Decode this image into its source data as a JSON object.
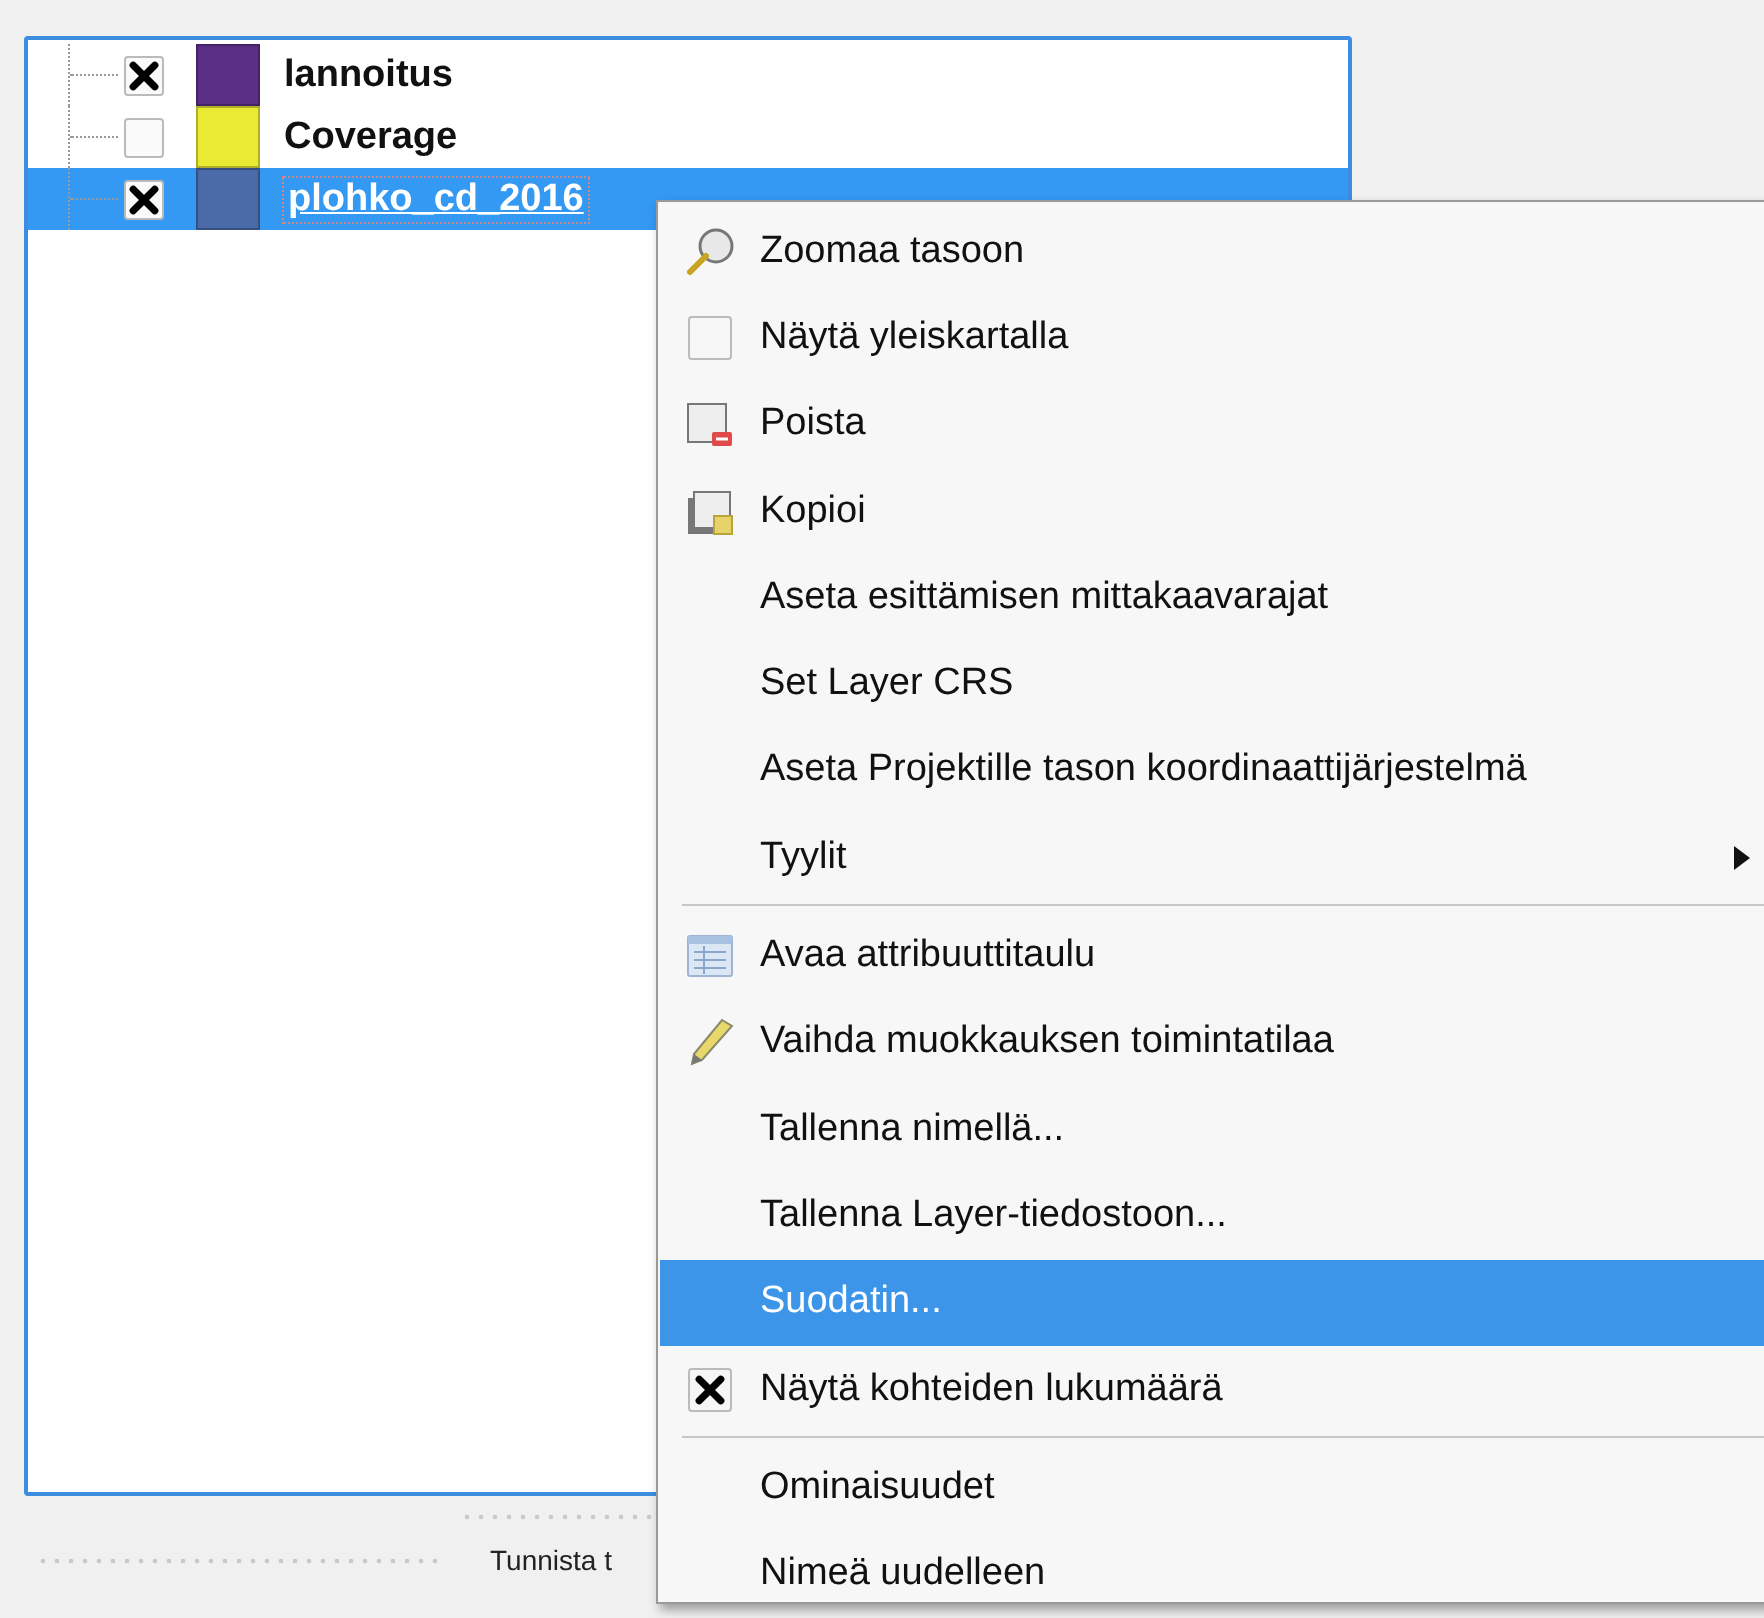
{
  "layers": [
    {
      "name": "lannoitus",
      "checked": true,
      "color": "#5b2f86",
      "selected": false
    },
    {
      "name": "Coverage",
      "checked": false,
      "color": "#eaea35",
      "selected": false
    },
    {
      "name": "plohko_cd_2016",
      "checked": true,
      "color": "#4a6aa8",
      "selected": true
    }
  ],
  "context_menu": [
    {
      "kind": "zoom",
      "label": "Zoomaa tasoon",
      "selected": false
    },
    {
      "kind": "checkbox",
      "label": "Näytä yleiskartalla",
      "checked": false,
      "selected": false
    },
    {
      "kind": "remove",
      "label": "Poista",
      "selected": false
    },
    {
      "kind": "copy",
      "label": "Kopioi",
      "selected": false
    },
    {
      "kind": "plain",
      "label": "Aseta esittämisen mittakaavarajat",
      "selected": false
    },
    {
      "kind": "plain",
      "label": "Set Layer CRS",
      "selected": false
    },
    {
      "kind": "plain",
      "label": "Aseta Projektille tason koordinaattijärjestelmä",
      "selected": false
    },
    {
      "kind": "submenu",
      "label": "Tyylit",
      "selected": false
    },
    {
      "kind": "separator"
    },
    {
      "kind": "table",
      "label": "Avaa attribuuttitaulu",
      "selected": false
    },
    {
      "kind": "edit",
      "label": "Vaihda muokkauksen toimintatilaa",
      "selected": false
    },
    {
      "kind": "plain",
      "label": "Tallenna nimellä...",
      "selected": false
    },
    {
      "kind": "plain",
      "label": "Tallenna Layer-tiedostoon...",
      "selected": false
    },
    {
      "kind": "plain",
      "label": "Suodatin...",
      "selected": true
    },
    {
      "kind": "checkbox",
      "label": "Näytä kohteiden lukumäärä",
      "checked": true,
      "selected": false
    },
    {
      "kind": "separator"
    },
    {
      "kind": "plain",
      "label": "Ominaisuudet",
      "selected": false
    },
    {
      "kind": "plain",
      "label": "Nimeä uudelleen",
      "selected": false
    }
  ],
  "status_bar": {
    "text": "Tunnista t"
  }
}
